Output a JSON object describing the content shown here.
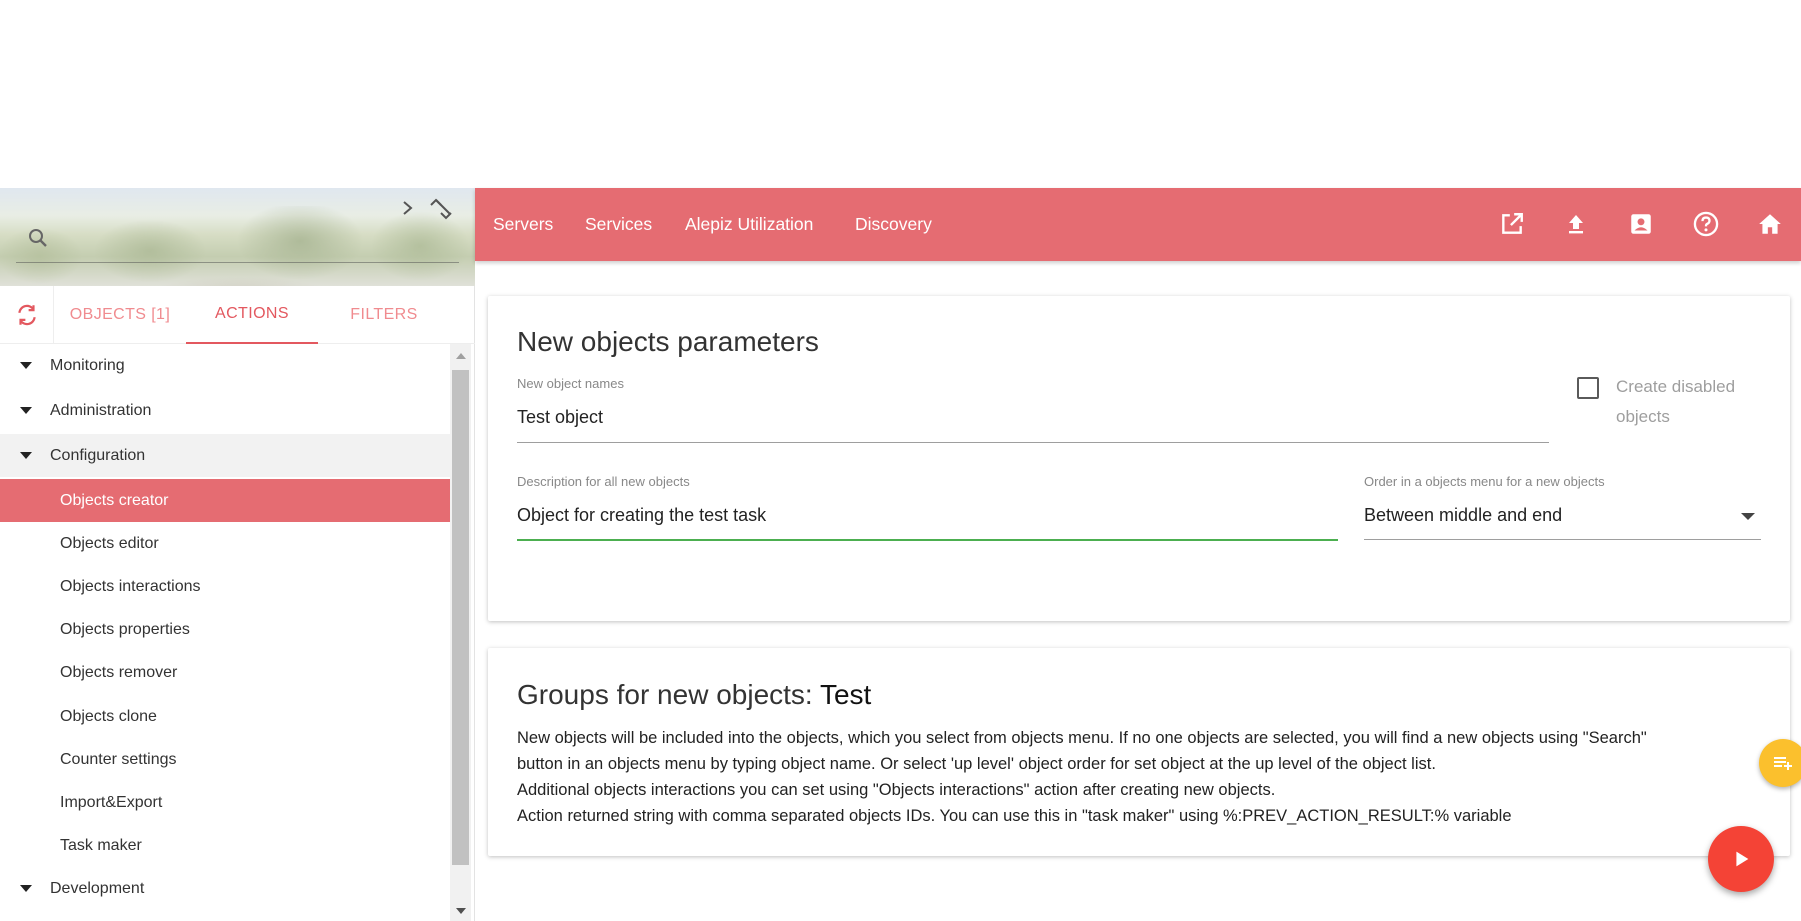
{
  "sidebar": {
    "tabs": [
      {
        "label": "OBJECTS [1]",
        "active": false
      },
      {
        "label": "ACTIONS",
        "active": true
      },
      {
        "label": "FILTERS",
        "active": false
      }
    ],
    "tree": [
      {
        "label": "Monitoring",
        "type": "group"
      },
      {
        "label": "Administration",
        "type": "group"
      },
      {
        "label": "Configuration",
        "type": "group"
      },
      {
        "label": "Objects creator",
        "type": "child",
        "selected": true
      },
      {
        "label": "Objects editor",
        "type": "child"
      },
      {
        "label": "Objects interactions",
        "type": "child"
      },
      {
        "label": "Objects properties",
        "type": "child"
      },
      {
        "label": "Objects remover",
        "type": "child"
      },
      {
        "label": "Objects clone",
        "type": "child"
      },
      {
        "label": "Counter settings",
        "type": "child"
      },
      {
        "label": "Import&Export",
        "type": "child"
      },
      {
        "label": "Task maker",
        "type": "child"
      },
      {
        "label": "Development",
        "type": "group"
      }
    ]
  },
  "nav": {
    "links": [
      "Servers",
      "Services",
      "Alepiz Utilization",
      "Discovery"
    ],
    "icons": [
      "open-in-new-icon",
      "upload-icon",
      "account-box-icon",
      "help-icon",
      "home-icon"
    ]
  },
  "params": {
    "title": "New objects parameters",
    "names_label": "New object names",
    "names_value": "Test object",
    "disabled_label": "Create disabled objects",
    "disabled_checked": false,
    "description_label": "Description for all new objects",
    "description_value": "Object for creating the test task",
    "order_label": "Order in a objects menu for a new objects",
    "order_value": "Between middle and end"
  },
  "groups": {
    "title_prefix": "Groups for new objects:",
    "title_value": "Test",
    "lines": [
      "New objects will be included into the objects, which you select from objects menu. If no one objects are selected, you will find a new objects using \"Search\"",
      "button in an objects menu by typing object name. Or select 'up level' object order for set object at the up level of the object list.",
      "Additional objects interactions you can set using \"Objects interactions\" action after creating new objects.",
      "Action returned string with comma separated objects IDs. You can use this in \"task maker\" using %:PREV_ACTION_RESULT:% variable"
    ]
  },
  "colors": {
    "accent": "#e56c72",
    "fab_yellow": "#fbc02d",
    "fab_red": "#f44336",
    "focus_green": "#4caf50"
  }
}
